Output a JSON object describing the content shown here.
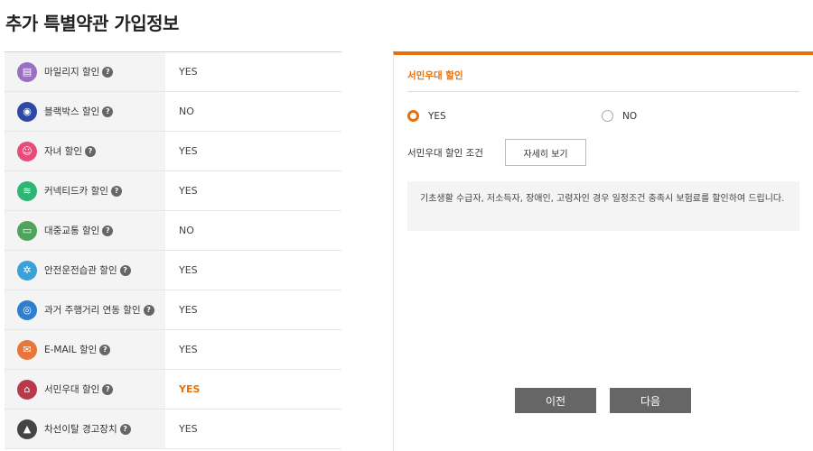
{
  "page": {
    "title": "추가 특별약관 가입정보"
  },
  "options": [
    {
      "label": "마일리지 할인",
      "value": "YES",
      "icon": "mileage-icon",
      "color": "#9a6fc4",
      "active": false
    },
    {
      "label": "블랙박스 할인",
      "value": "NO",
      "icon": "blackbox-icon",
      "color": "#2c4aa5",
      "active": false
    },
    {
      "label": "자녀 할인",
      "value": "YES",
      "icon": "child-icon",
      "color": "#e84a7a",
      "active": false
    },
    {
      "label": "커넥티드카 할인",
      "value": "YES",
      "icon": "connected-car-icon",
      "color": "#2bb673",
      "active": false
    },
    {
      "label": "대중교통 할인",
      "value": "NO",
      "icon": "bus-icon",
      "color": "#4fa35a",
      "active": false
    },
    {
      "label": "안전운전습관 할인",
      "value": "YES",
      "icon": "steering-wheel-icon",
      "color": "#3aa0d8",
      "active": false
    },
    {
      "label": "과거 주행거리 연동 할인",
      "value": "YES",
      "icon": "odometer-icon",
      "color": "#2f7fd0",
      "active": false
    },
    {
      "label": "E-MAIL 할인",
      "value": "YES",
      "icon": "email-icon",
      "color": "#e8763a",
      "active": false
    },
    {
      "label": "서민우대 할인",
      "value": "YES",
      "icon": "shop-icon",
      "color": "#b83a4a",
      "active": true
    },
    {
      "label": "차선이탈 경고장치",
      "value": "YES",
      "icon": "lane-departure-icon",
      "color": "#444444",
      "active": false
    }
  ],
  "detail": {
    "title": "서민우대 할인",
    "yes_label": "YES",
    "no_label": "NO",
    "selected": "YES",
    "condition_label": "서민우대 할인 조건",
    "condition_button": "자세히 보기",
    "info_text": "기초생활 수급자, 저소득자, 장애인, 고령자인 경우 일정조건 충족시 보험료를 할인하여 드립니다."
  },
  "nav": {
    "prev_label": "이전",
    "next_label": "다음"
  },
  "colors": {
    "accent": "#e8700a",
    "button_dark": "#666666",
    "row_label_bg": "#f4f4f4"
  }
}
